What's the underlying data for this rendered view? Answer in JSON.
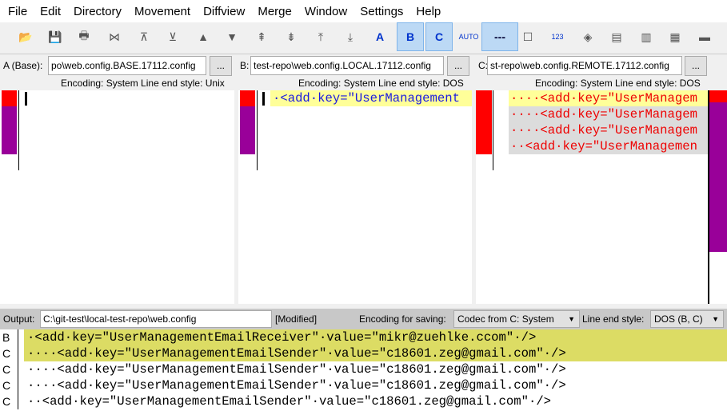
{
  "menu": [
    "File",
    "Edit",
    "Directory",
    "Movement",
    "Diffview",
    "Merge",
    "Window",
    "Settings",
    "Help"
  ],
  "toolbar": [
    {
      "icon": "open-folder-icon",
      "glyph": "📂"
    },
    {
      "icon": "save-icon",
      "glyph": "💾"
    },
    {
      "icon": "print-icon",
      "glyph": "🖶"
    },
    {
      "icon": "go-current-icon",
      "glyph": "⋈"
    },
    {
      "icon": "go-top-icon",
      "glyph": "⊼"
    },
    {
      "icon": "go-bottom-icon",
      "glyph": "⊻"
    },
    {
      "icon": "prev-delta-icon",
      "glyph": "▲"
    },
    {
      "icon": "next-delta-icon",
      "glyph": "▼"
    },
    {
      "icon": "prev-conflict-icon",
      "glyph": "⇞"
    },
    {
      "icon": "next-conflict-icon",
      "glyph": "⇟"
    },
    {
      "icon": "prev-unsolved-icon",
      "glyph": "⤒"
    },
    {
      "icon": "next-unsolved-icon",
      "glyph": "⤓"
    },
    {
      "icon": "select-a-icon",
      "glyph": "A"
    },
    {
      "icon": "select-b-icon",
      "glyph": "B",
      "active": true
    },
    {
      "icon": "select-c-icon",
      "glyph": "C",
      "active": true
    },
    {
      "icon": "auto-advance-icon",
      "glyph": "AUTO"
    },
    {
      "icon": "show-whitespace-icon",
      "glyph": "---",
      "active": true
    },
    {
      "icon": "show-space-chars-icon",
      "glyph": "☐"
    },
    {
      "icon": "line-numbers-icon",
      "glyph": "123"
    },
    {
      "icon": "diamond-icon",
      "glyph": "◈"
    },
    {
      "icon": "split-3-icon",
      "glyph": "▤"
    },
    {
      "icon": "split-2-icon",
      "glyph": "▥"
    },
    {
      "icon": "split-h-icon",
      "glyph": "▦"
    },
    {
      "icon": "toggle-icon",
      "glyph": "▬"
    }
  ],
  "files": {
    "a": {
      "label": "A (Base):",
      "path": "po\\web.config.BASE.17112.config",
      "encoding": "Encoding: System Line end style: Unix"
    },
    "b": {
      "label": "B:",
      "path": "test-repo\\web.config.LOCAL.17112.config",
      "encoding": "Encoding: System Line end style: DOS"
    },
    "c": {
      "label": "C:",
      "path": "st-repo\\web.config.REMOTE.17112.config",
      "encoding": "Encoding: System Line end style: DOS"
    },
    "browse": "..."
  },
  "pane_b": [
    "·<add·key=\"UserManagement"
  ],
  "pane_c": [
    "····<add·key=\"UserManagem",
    "····<add·key=\"UserManagem",
    "····<add·key=\"UserManagem",
    "··<add·key=\"UserManagemen"
  ],
  "output": {
    "label": "Output:",
    "path": "C:\\git-test\\local-test-repo\\web.config",
    "status": "[Modified]",
    "encoding_label": "Encoding for saving:",
    "encoding_value": "Codec from C: System",
    "lineend_label": "Line end style:",
    "lineend_value": "DOS (B, C)",
    "lines": [
      {
        "src": "B",
        "text": "·<add·key=\"UserManagementEmailReceiver\"·value=\"mikr@zuehlke.ccom\"·/>"
      },
      {
        "src": "C",
        "text": "····<add·key=\"UserManagementEmailSender\"·value=\"c18601.zeg@gmail.com\"·/>"
      },
      {
        "src": "C",
        "text": "····<add·key=\"UserManagementEmailSender\"·value=\"c18601.zeg@gmail.com\"·/>"
      },
      {
        "src": "C",
        "text": "····<add·key=\"UserManagementEmailSender\"·value=\"c18601.zeg@gmail.com\"·/>"
      },
      {
        "src": "C",
        "text": "··<add·key=\"UserManagementEmailSender\"·value=\"c18601.zeg@gmail.com\"·/>"
      }
    ]
  },
  "colors": {
    "conflict": "#ff0000",
    "change": "#990099",
    "current_line": "#ffff99",
    "merge_selected": "#dcdc64",
    "grey_block": "#dcdcdc"
  }
}
